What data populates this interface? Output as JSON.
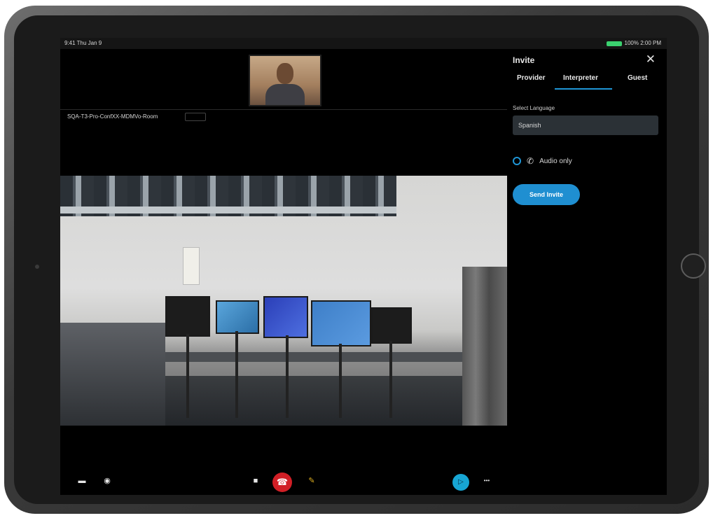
{
  "status_bar": {
    "time_date": "9:41 Thu Jan 9",
    "right_text": "100% 2:00 PM"
  },
  "call": {
    "room_label": "SQA-T3-Pro-ConfXX-MDMVo-Room"
  },
  "controls": {
    "camera_icon": "camera-icon",
    "mic_icon": "microphone-icon",
    "video_icon": "video-icon",
    "end_icon": "phone-end-icon",
    "mute_icon": "mute-icon",
    "share_icon": "share-icon",
    "more_label": "•••"
  },
  "invite_panel": {
    "title": "Invite",
    "close_label": "✕",
    "tabs": [
      {
        "label": "Provider"
      },
      {
        "label": "Interpreter"
      },
      {
        "label": "Guest"
      }
    ],
    "active_tab": "Interpreter",
    "language_label": "Select Language",
    "language_value": "Spanish",
    "audio_only_label": "Audio only",
    "send_button": "Send Invite"
  },
  "colors": {
    "accent": "#1f96d6",
    "end_call": "#d11f26",
    "battery": "#3bd16f"
  }
}
